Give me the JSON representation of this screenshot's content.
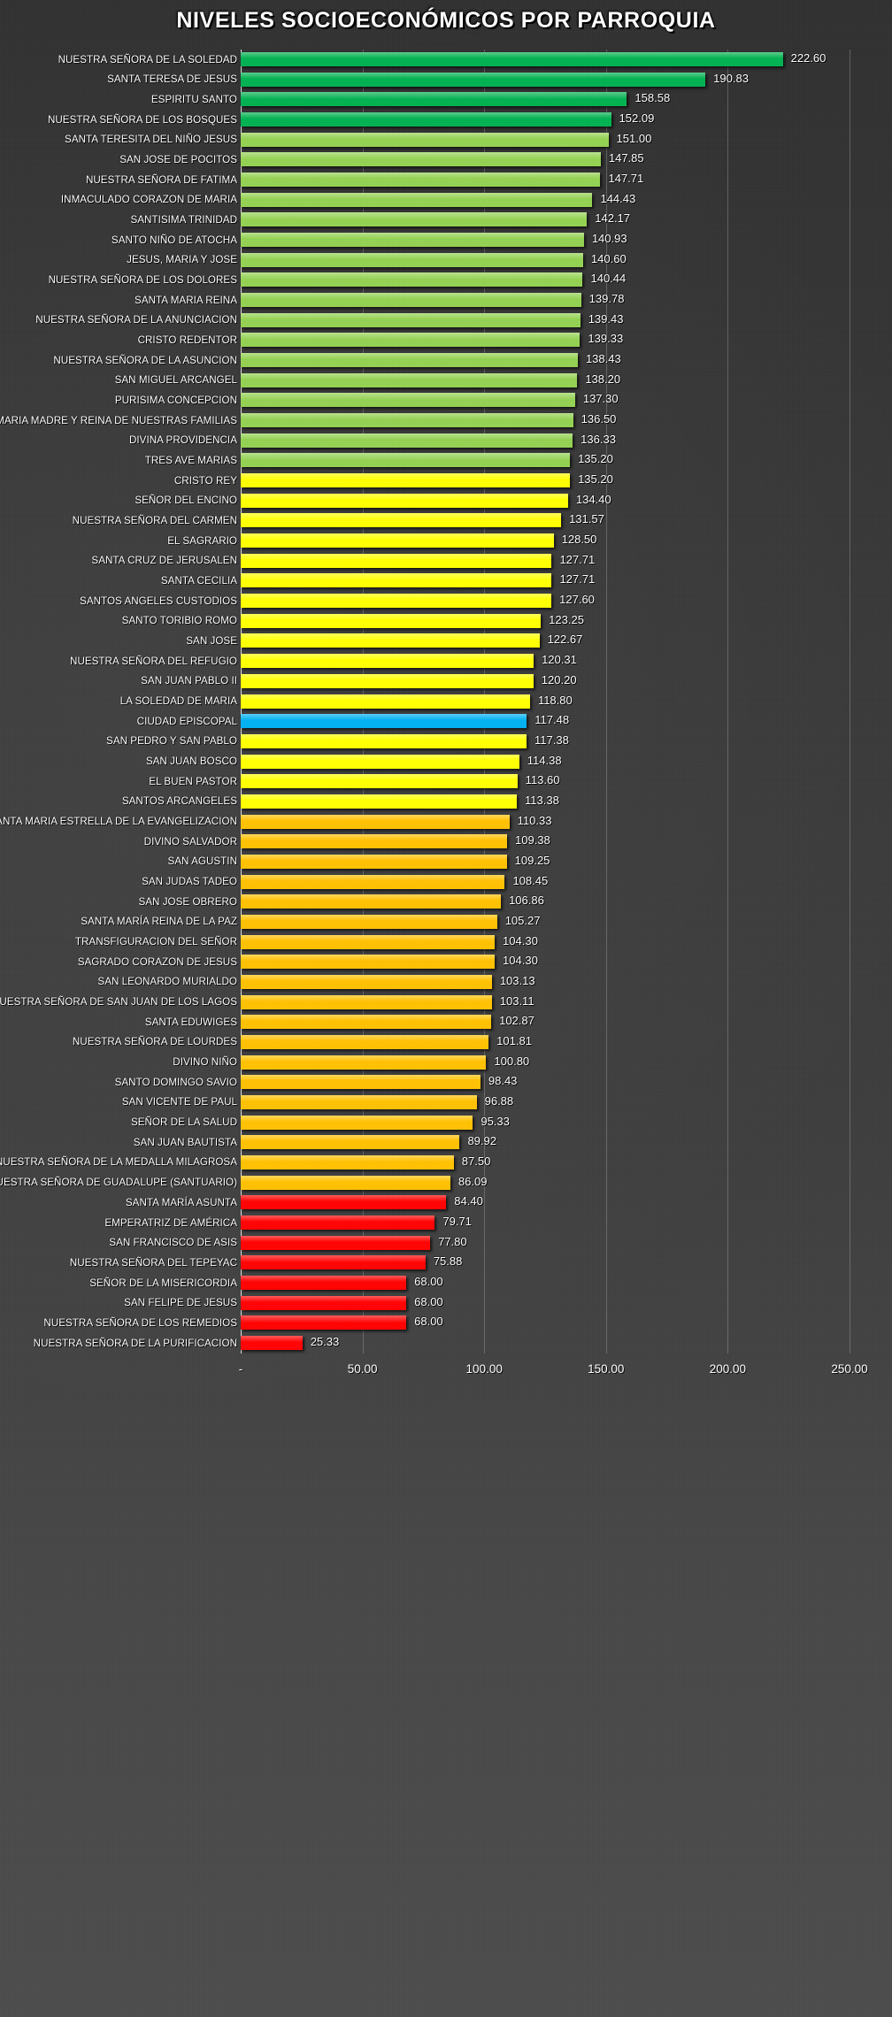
{
  "title": "NIVELES SOCIOECONÓMICOS POR PARROQUIA",
  "colors": {
    "background": "#3a3a3a",
    "text": "#ffffff",
    "gridline": "#bebebe",
    "axis_line": "#f0f0f0",
    "dark_green": "#00b04f",
    "light_green": "#92d050",
    "yellow": "#ffff00",
    "amber": "#ffc000",
    "red": "#ff0000",
    "highlight_cyan": "#00b0f0"
  },
  "chart_data": {
    "type": "bar",
    "orientation": "horizontal",
    "title": "NIVELES SOCIOECONÓMICOS POR PARROQUIA",
    "xlabel": "",
    "ylabel": "",
    "xlim": [
      0,
      250
    ],
    "xticks": [
      "-",
      "50.00",
      "100.00",
      "150.00",
      "200.00",
      "250.00"
    ],
    "xtick_values": [
      0,
      50,
      100,
      150,
      200,
      250
    ],
    "grid": true,
    "legend": false,
    "value_format": "0.00",
    "categories": [
      "NUESTRA SEÑORA DE LA SOLEDAD",
      "SANTA TERESA DE JESUS",
      "ESPIRITU SANTO",
      "NUESTRA SEÑORA DE LOS BOSQUES",
      "SANTA TERESITA DEL NIÑO JESUS",
      "SAN JOSE DE POCITOS",
      "NUESTRA SEÑORA DE FATIMA",
      "INMACULADO CORAZON DE MARIA",
      "SANTISIMA TRINIDAD",
      "SANTO NIÑO DE ATOCHA",
      "JESUS, MARIA Y JOSE",
      "NUESTRA SEÑORA DE LOS DOLORES",
      "SANTA MARIA REINA",
      "NUESTRA SEÑORA DE LA ANUNCIACION",
      "CRISTO REDENTOR",
      "NUESTRA SEÑORA DE LA ASUNCION",
      "SAN MIGUEL ARCANGEL",
      "PURISIMA CONCEPCION",
      "MARIA MADRE Y REINA DE NUESTRAS FAMILIAS",
      "DIVINA PROVIDENCIA",
      "TRES AVE MARIAS",
      "CRISTO REY",
      "SEÑOR DEL ENCINO",
      "NUESTRA SEÑORA DEL CARMEN",
      "EL SAGRARIO",
      "SANTA CRUZ DE JERUSALEN",
      "SANTA CECILIA",
      "SANTOS ANGELES CUSTODIOS",
      "SANTO TORIBIO ROMO",
      "SAN JOSE",
      "NUESTRA SEÑORA DEL REFUGIO",
      "SAN JUAN PABLO II",
      "LA SOLEDAD DE MARIA",
      "CIUDAD EPISCOPAL",
      "SAN PEDRO Y SAN PABLO",
      "SAN JUAN BOSCO",
      "EL BUEN PASTOR",
      "SANTOS ARCANGELES",
      "SANTA MARIA ESTRELLA DE LA EVANGELIZACION",
      "DIVINO SALVADOR",
      "SAN AGUSTIN",
      "SAN JUDAS TADEO",
      "SAN JOSE OBRERO",
      "SANTA MARÍA REINA DE LA PAZ",
      "TRANSFIGURACION DEL SEÑOR",
      "SAGRADO CORAZON DE JESUS",
      "SAN LEONARDO MURIALDO",
      "NUESTRA SEÑORA DE SAN JUAN DE LOS LAGOS",
      "SANTA EDUWIGES",
      "NUESTRA SEÑORA DE LOURDES",
      "DIVINO NIÑO",
      "SANTO DOMINGO SAVIO",
      "SAN VICENTE DE PAUL",
      "SEÑOR DE LA SALUD",
      "SAN JUAN BAUTISTA",
      "NUESTRA SEÑORA DE LA MEDALLA MILAGROSA",
      "NUESTRA SEÑORA DE GUADALUPE (SANTUARIO)",
      "SANTA MARÍA ASUNTA",
      "EMPERATRIZ DE AMÉRICA",
      "SAN FRANCISCO DE ASIS",
      "NUESTRA SEÑORA DEL TEPEYAC",
      "SEÑOR DE LA MISERICORDIA",
      "SAN FELIPE DE JESUS",
      "NUESTRA SEÑORA DE LOS REMEDIOS",
      "NUESTRA SEÑORA DE LA PURIFICACION"
    ],
    "values": [
      222.6,
      190.83,
      158.58,
      152.09,
      151.0,
      147.85,
      147.71,
      144.43,
      142.17,
      140.93,
      140.6,
      140.44,
      139.78,
      139.43,
      139.33,
      138.43,
      138.2,
      137.3,
      136.5,
      136.33,
      135.2,
      135.2,
      134.4,
      131.57,
      128.5,
      127.71,
      127.71,
      127.6,
      123.25,
      122.67,
      120.31,
      120.2,
      118.8,
      117.48,
      117.38,
      114.38,
      113.6,
      113.38,
      110.33,
      109.38,
      109.25,
      108.45,
      106.86,
      105.27,
      104.3,
      104.3,
      103.13,
      103.11,
      102.87,
      101.81,
      100.8,
      98.43,
      96.88,
      95.33,
      89.92,
      87.5,
      86.09,
      84.4,
      79.71,
      77.8,
      75.88,
      68.0,
      68.0,
      68.0,
      25.33
    ],
    "value_labels": [
      "222.60",
      "190.83",
      "158.58",
      "152.09",
      "151.00",
      "147.85",
      "147.71",
      "144.43",
      "142.17",
      "140.93",
      "140.60",
      "140.44",
      "139.78",
      "139.43",
      "139.33",
      "138.43",
      "138.20",
      "137.30",
      "136.50",
      "136.33",
      "135.20",
      "135.20",
      "134.40",
      "131.57",
      "128.50",
      "127.71",
      "127.71",
      "127.60",
      "123.25",
      "122.67",
      "120.31",
      "120.20",
      "118.80",
      "117.48",
      "117.38",
      "114.38",
      "113.60",
      "113.38",
      "110.33",
      "109.38",
      "109.25",
      "108.45",
      "106.86",
      "105.27",
      "104.30",
      "104.30",
      "103.13",
      "103.11",
      "102.87",
      "101.81",
      "100.80",
      "98.43",
      "96.88",
      "95.33",
      "89.92",
      "87.50",
      "86.09",
      "84.40",
      "79.71",
      "77.80",
      "75.88",
      "68.00",
      "68.00",
      "68.00",
      "25.33"
    ],
    "bar_colors": [
      "#00b04f",
      "#00b04f",
      "#00b04f",
      "#00b04f",
      "#92d050",
      "#92d050",
      "#92d050",
      "#92d050",
      "#92d050",
      "#92d050",
      "#92d050",
      "#92d050",
      "#92d050",
      "#92d050",
      "#92d050",
      "#92d050",
      "#92d050",
      "#92d050",
      "#92d050",
      "#92d050",
      "#92d050",
      "#ffff00",
      "#ffff00",
      "#ffff00",
      "#ffff00",
      "#ffff00",
      "#ffff00",
      "#ffff00",
      "#ffff00",
      "#ffff00",
      "#ffff00",
      "#ffff00",
      "#ffff00",
      "#00b0f0",
      "#ffff00",
      "#ffff00",
      "#ffff00",
      "#ffff00",
      "#ffc000",
      "#ffc000",
      "#ffc000",
      "#ffc000",
      "#ffc000",
      "#ffc000",
      "#ffc000",
      "#ffc000",
      "#ffc000",
      "#ffc000",
      "#ffc000",
      "#ffc000",
      "#ffc000",
      "#ffc000",
      "#ffc000",
      "#ffc000",
      "#ffc000",
      "#ffc000",
      "#ffc000",
      "#ff0000",
      "#ff0000",
      "#ff0000",
      "#ff0000",
      "#ff0000",
      "#ff0000",
      "#ff0000",
      "#ff0000"
    ]
  }
}
